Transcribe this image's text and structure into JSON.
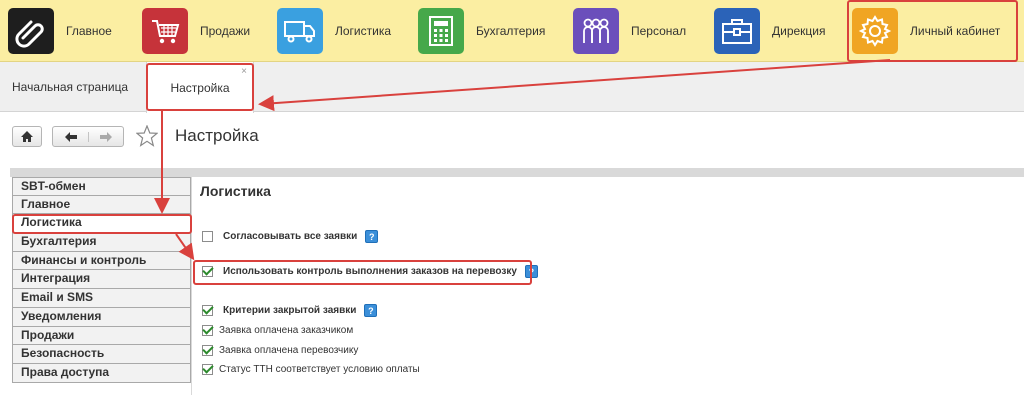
{
  "nav": [
    {
      "label": "Главное",
      "icon": "paperclip-icon",
      "color": "#1e1e1e"
    },
    {
      "label": "Продажи",
      "icon": "cart-icon",
      "color": "#c6333a"
    },
    {
      "label": "Логистика",
      "icon": "truck-icon",
      "color": "#3aa0e0"
    },
    {
      "label": "Бухгалтерия",
      "icon": "calculator-icon",
      "color": "#46a84a"
    },
    {
      "label": "Персонал",
      "icon": "people-icon",
      "color": "#6b4fbb"
    },
    {
      "label": "Дирекция",
      "icon": "briefcase-icon",
      "color": "#2b63b8"
    },
    {
      "label": "Личный кабинет",
      "icon": "gear-icon",
      "color": "#f0a523"
    }
  ],
  "tabs": {
    "home": "Начальная страница",
    "settings": "Настройка",
    "close": "×"
  },
  "page": {
    "title": "Настройка"
  },
  "sidebar": [
    "SBT-обмен",
    "Главное",
    "Логистика",
    "Бухгалтерия",
    "Финансы и контроль",
    "Интеграция",
    "Email и SMS",
    "Уведомления",
    "Продажи",
    "Безопасность",
    "Права доступа"
  ],
  "content": {
    "title": "Логистика",
    "opt_approve": "Согласовывать все заявки",
    "opt_control": "Использовать контроль выполнения заказов на перевозку",
    "opt_criteria": "Критерии закрытой заявки",
    "opt_paid_customer": "Заявка оплачена заказчиком",
    "opt_paid_carrier": "Заявка оплачена перевозчику",
    "opt_ttn": "Статус ТТН соответствует условию оплаты",
    "help_glyph": "?"
  }
}
